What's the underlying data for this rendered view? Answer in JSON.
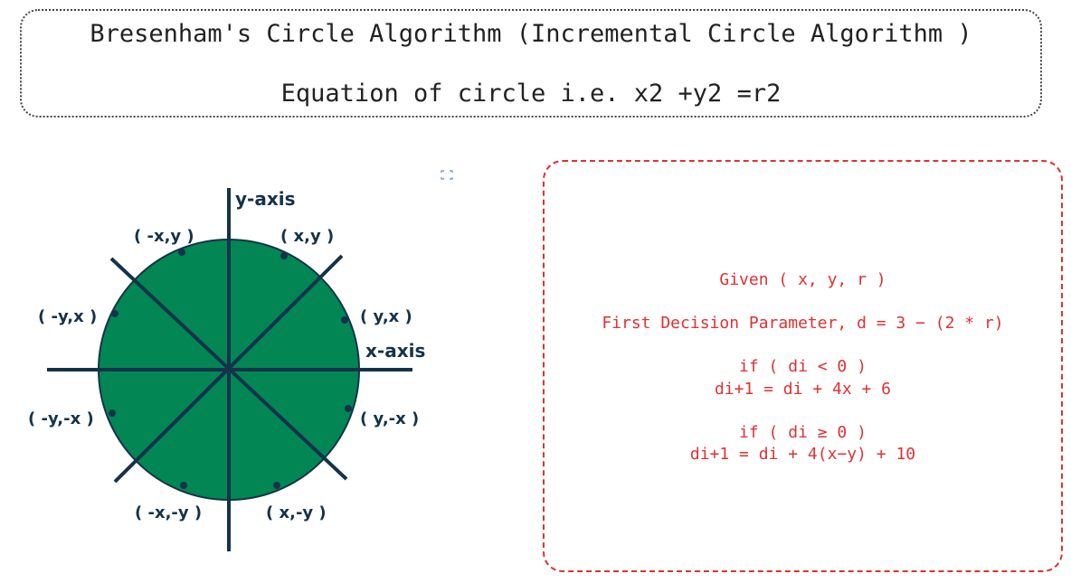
{
  "header": {
    "title": "Bresenham's Circle Algorithm (Incremental Circle Algorithm )",
    "subtitle": "Equation of circle i.e. x2 +y2 =r2"
  },
  "diagram": {
    "circle_fill": "#028654",
    "line_color": "#14334a",
    "axis_labels": {
      "y": "y-axis",
      "x": "x-axis"
    },
    "octant_labels": [
      {
        "id": "x-y-pos",
        "text": "( x,y )"
      },
      {
        "id": "y-x-pos",
        "text": "( y,x )"
      },
      {
        "id": "y-negx",
        "text": "( y,-x )"
      },
      {
        "id": "x-negy",
        "text": "( x,-y )"
      },
      {
        "id": "negx-negy",
        "text": "( -x,-y )"
      },
      {
        "id": "negy-negx",
        "text": "( -y,-x )"
      },
      {
        "id": "negy-x",
        "text": "( -y,x )"
      },
      {
        "id": "negx-y",
        "text": "( -x,y )"
      }
    ]
  },
  "rules": {
    "border_color": "#e03131",
    "given": "Given ( x, y, r )",
    "first_decision": "First Decision Parameter, d = 3 − (2 * r)",
    "condition_1": "if ( di < 0 )",
    "update_1": "di+1 = di + 4x + 6",
    "condition_2": "if ( di ≥ 0 )",
    "update_2": "di+1 = di + 4(x−y) + 10"
  }
}
